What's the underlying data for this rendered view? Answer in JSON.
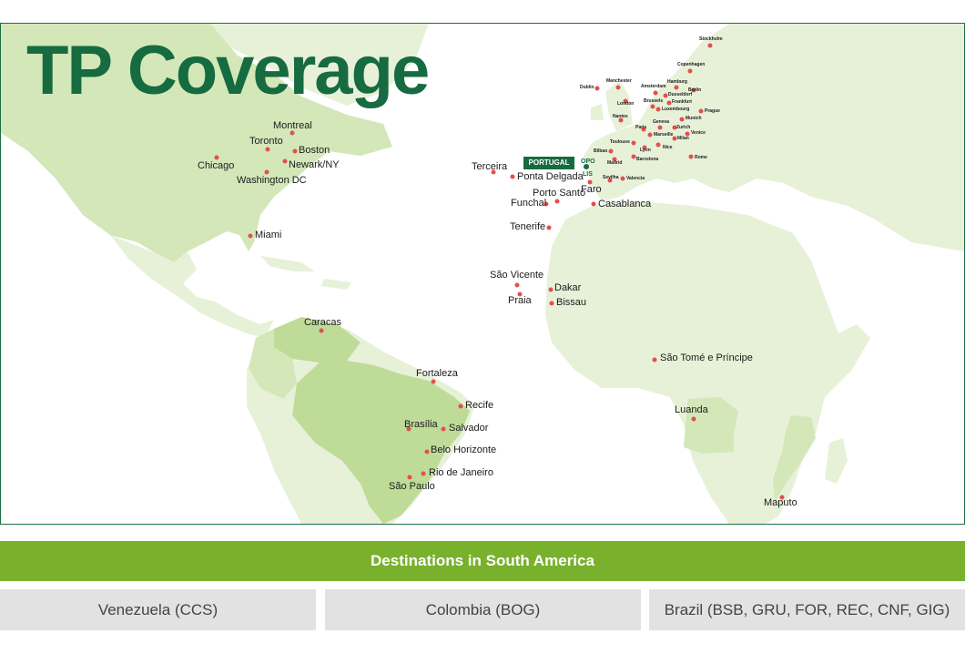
{
  "map": {
    "title": "TP Coverage",
    "hub": {
      "tag": "PORTUGAL",
      "codes": [
        "OPO",
        "LIS"
      ]
    },
    "cities": [
      {
        "name": "Montreal",
        "size": "lg"
      },
      {
        "name": "Toronto",
        "size": "lg"
      },
      {
        "name": "Boston",
        "size": "lg"
      },
      {
        "name": "Chicago",
        "size": "lg"
      },
      {
        "name": "Newark/NY",
        "size": "lg"
      },
      {
        "name": "Washington DC",
        "size": "lg"
      },
      {
        "name": "Miami",
        "size": "lg"
      },
      {
        "name": "Caracas",
        "size": "lg"
      },
      {
        "name": "Fortaleza",
        "size": "lg"
      },
      {
        "name": "Recife",
        "size": "lg"
      },
      {
        "name": "Brasília",
        "size": "lg"
      },
      {
        "name": "Salvador",
        "size": "lg"
      },
      {
        "name": "Belo Horizonte",
        "size": "lg"
      },
      {
        "name": "Rio de Janeiro",
        "size": "lg"
      },
      {
        "name": "São Paulo",
        "size": "lg"
      },
      {
        "name": "Terceira",
        "size": "lg"
      },
      {
        "name": "Ponta Delgada",
        "size": "lg"
      },
      {
        "name": "Porto Santo",
        "size": "lg"
      },
      {
        "name": "Funchal",
        "size": "lg"
      },
      {
        "name": "Faro",
        "size": "lg"
      },
      {
        "name": "Casablanca",
        "size": "lg"
      },
      {
        "name": "Tenerife",
        "size": "lg"
      },
      {
        "name": "São Vicente",
        "size": "lg"
      },
      {
        "name": "Praia",
        "size": "lg"
      },
      {
        "name": "Dakar",
        "size": "lg"
      },
      {
        "name": "Bissau",
        "size": "lg"
      },
      {
        "name": "São Tomé e Príncipe",
        "size": "lg"
      },
      {
        "name": "Luanda",
        "size": "lg"
      },
      {
        "name": "Maputo",
        "size": "lg"
      },
      {
        "name": "Stockholm",
        "size": "sm"
      },
      {
        "name": "Copenhagen",
        "size": "sm"
      },
      {
        "name": "Dublin",
        "size": "sm"
      },
      {
        "name": "Manchester",
        "size": "sm"
      },
      {
        "name": "Hamburg",
        "size": "sm"
      },
      {
        "name": "Amsterdam",
        "size": "sm"
      },
      {
        "name": "Berlin",
        "size": "sm"
      },
      {
        "name": "Dusseldorf",
        "size": "sm"
      },
      {
        "name": "London",
        "size": "sm"
      },
      {
        "name": "Brussels",
        "size": "sm"
      },
      {
        "name": "Frankfurt",
        "size": "sm"
      },
      {
        "name": "Luxembourg",
        "size": "sm"
      },
      {
        "name": "Prague",
        "size": "sm"
      },
      {
        "name": "Nantes",
        "size": "sm"
      },
      {
        "name": "Munich",
        "size": "sm"
      },
      {
        "name": "Paris",
        "size": "sm"
      },
      {
        "name": "Geneva",
        "size": "sm"
      },
      {
        "name": "Zurich",
        "size": "sm"
      },
      {
        "name": "Marseille",
        "size": "sm"
      },
      {
        "name": "Venice",
        "size": "sm"
      },
      {
        "name": "Milan",
        "size": "sm"
      },
      {
        "name": "Toulouse",
        "size": "sm"
      },
      {
        "name": "Lyon",
        "size": "sm"
      },
      {
        "name": "Nice",
        "size": "sm"
      },
      {
        "name": "Bilbao",
        "size": "sm"
      },
      {
        "name": "Madrid",
        "size": "sm"
      },
      {
        "name": "Barcelona",
        "size": "sm"
      },
      {
        "name": "Rome",
        "size": "sm"
      },
      {
        "name": "Sevilha",
        "size": "sm"
      },
      {
        "name": "Valencia",
        "size": "sm"
      }
    ]
  },
  "destinations": {
    "heading": "Destinations in South America",
    "items": [
      "Venezuela (CCS)",
      "Colombia (BOG)",
      "Brazil (BSB, GRU, FOR, REC, CNF, GIG)"
    ]
  },
  "colors": {
    "brand_green": "#166b40",
    "banner_green": "#79b12d",
    "land_light": "#e7f1d8",
    "land_medium": "#d3e7b9",
    "land_dark": "#bedb98",
    "city_dot": "#e2504d"
  }
}
